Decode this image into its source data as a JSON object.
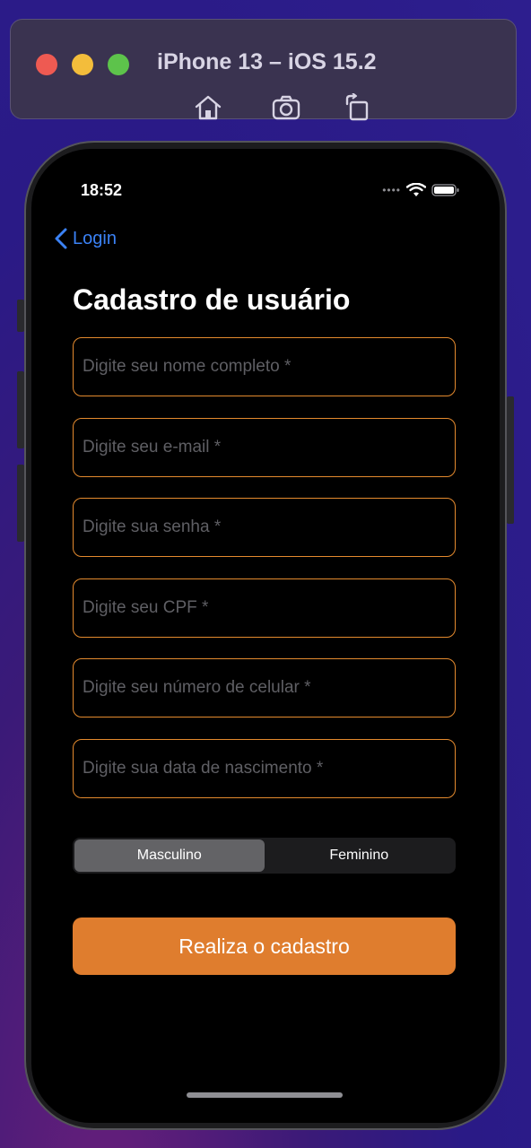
{
  "simulator": {
    "title": "iPhone 13 – iOS 15.2",
    "toolbar_icons": [
      "home-icon",
      "screenshot-icon",
      "rotate-icon"
    ]
  },
  "status_bar": {
    "time": "18:52",
    "icons": [
      "signal-dots-icon",
      "wifi-icon",
      "battery-icon"
    ]
  },
  "nav": {
    "back_label": "Login"
  },
  "page": {
    "title": "Cadastro de usuário"
  },
  "form": {
    "fields": [
      {
        "placeholder": "Digite seu nome completo *",
        "value": ""
      },
      {
        "placeholder": "Digite seu e-mail *",
        "value": ""
      },
      {
        "placeholder": "Digite sua senha *",
        "value": ""
      },
      {
        "placeholder": "Digite seu CPF *",
        "value": ""
      },
      {
        "placeholder": "Digite seu número de celular *",
        "value": ""
      },
      {
        "placeholder": "Digite sua data de nascimento *",
        "value": ""
      }
    ],
    "gender_options": [
      "Masculino",
      "Feminino"
    ],
    "gender_selected": "Masculino",
    "submit_label": "Realiza o cadastro"
  },
  "colors": {
    "accent": "#df7d2e",
    "field_border": "#e48a2e",
    "link": "#3b82f6",
    "background": "#000000"
  }
}
